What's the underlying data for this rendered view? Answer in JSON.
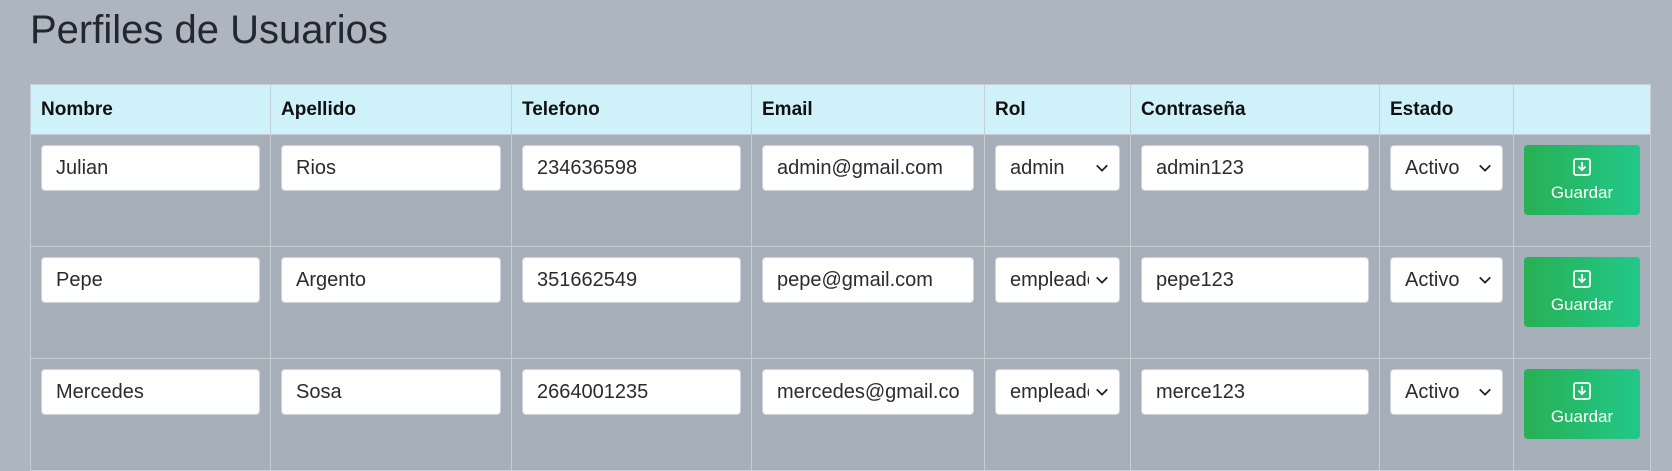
{
  "page": {
    "title": "Perfiles de Usuarios"
  },
  "table": {
    "headers": [
      "Nombre",
      "Apellido",
      "Telefono",
      "Email",
      "Rol",
      "Contraseña",
      "Estado",
      ""
    ],
    "rows": [
      {
        "nombre": "Julian",
        "apellido": "Rios",
        "telefono": "234636598",
        "email": "admin@gmail.com",
        "rol": "admin",
        "contrasena": "admin123",
        "estado": "Activo",
        "action": "Guardar"
      },
      {
        "nombre": "Pepe",
        "apellido": "Argento",
        "telefono": "351662549",
        "email": "pepe@gmail.com",
        "rol": "empleado",
        "contrasena": "pepe123",
        "estado": "Activo",
        "action": "Guardar"
      },
      {
        "nombre": "Mercedes",
        "apellido": "Sosa",
        "telefono": "2664001235",
        "email": "mercedes@gmail.com",
        "rol": "empleado",
        "contrasena": "merce123",
        "estado": "Activo",
        "action": "Guardar"
      }
    ]
  },
  "icons": {
    "select": "chevron-down-icon",
    "save": "download-save-icon"
  },
  "colors": {
    "background": "#adb5c1",
    "header": "#cff2fa",
    "button_start": "#28b054",
    "button_end": "#22c88a"
  }
}
